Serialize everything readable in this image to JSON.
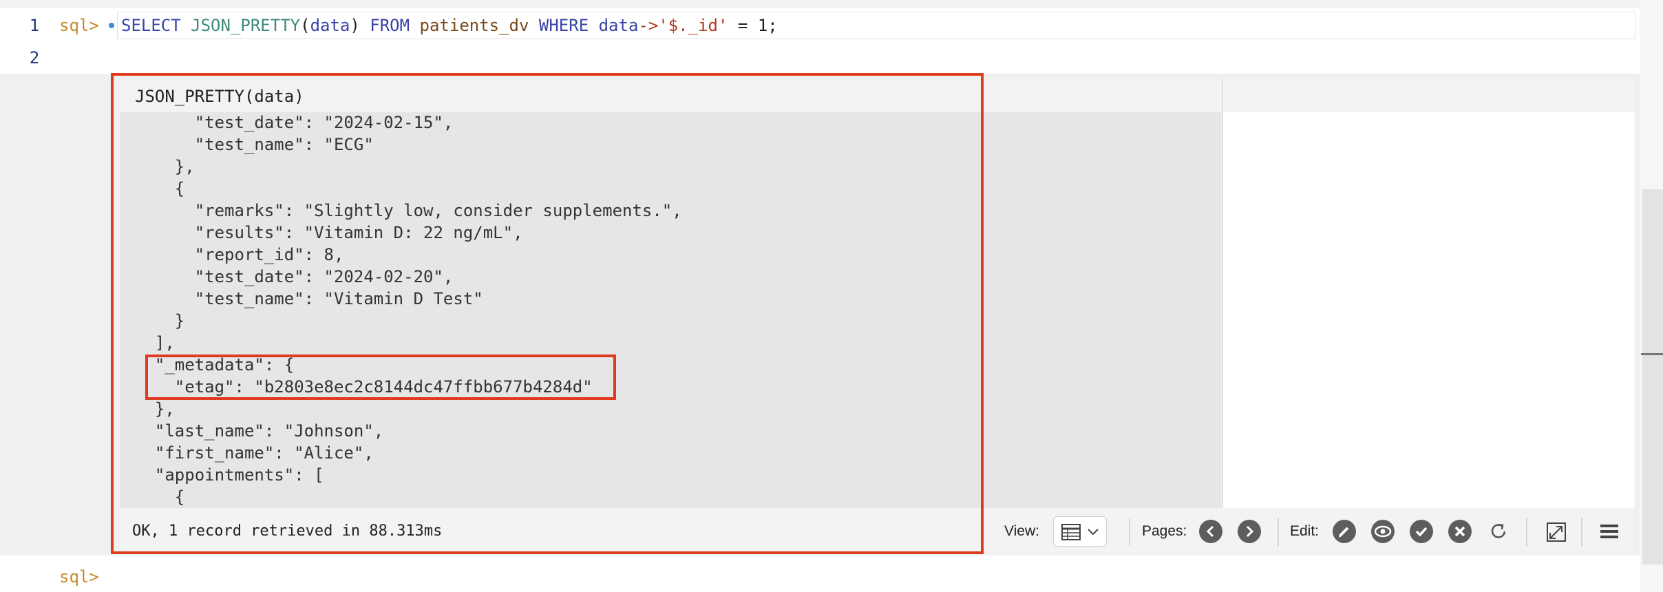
{
  "editor": {
    "line_numbers": [
      "1",
      "2"
    ],
    "prompt": "sql>",
    "query_tokens": [
      {
        "text": "SELECT ",
        "cls": "kw"
      },
      {
        "text": "JSON_PRETTY",
        "cls": "fn"
      },
      {
        "text": "(",
        "cls": "plain"
      },
      {
        "text": "data",
        "cls": "id"
      },
      {
        "text": ") ",
        "cls": "plain"
      },
      {
        "text": "FROM ",
        "cls": "kw"
      },
      {
        "text": "patients_dv ",
        "cls": "tbl"
      },
      {
        "text": "WHERE ",
        "cls": "kw"
      },
      {
        "text": "data",
        "cls": "id"
      },
      {
        "text": "->",
        "cls": "op"
      },
      {
        "text": "'$._id'",
        "cls": "str"
      },
      {
        "text": " = ",
        "cls": "plain"
      },
      {
        "text": "1",
        "cls": "plain"
      },
      {
        "text": ";",
        "cls": "plain"
      }
    ]
  },
  "result": {
    "column_header": "JSON_PRETTY(data)",
    "json_lines": [
      "      \"test_date\": \"2024-02-15\",",
      "      \"test_name\": \"ECG\"",
      "    },",
      "    {",
      "      \"remarks\": \"Slightly low, consider supplements.\",",
      "      \"results\": \"Vitamin D: 22 ng/mL\",",
      "      \"report_id\": 8,",
      "      \"test_date\": \"2024-02-20\",",
      "      \"test_name\": \"Vitamin D Test\"",
      "    }",
      "  ],",
      "  \"_metadata\": {",
      "    \"etag\": \"b2803e8ec2c8144dc47ffbb677b4284d\"",
      "  },",
      "  \"last_name\": \"Johnson\",",
      "  \"first_name\": \"Alice\",",
      "  \"appointments\": [",
      "    {"
    ],
    "status": "OK, 1 record retrieved in 88.313ms"
  },
  "toolbar": {
    "view_label": "View:",
    "pages_label": "Pages:",
    "edit_label": "Edit:",
    "icons": [
      "table-view-icon",
      "chevron-down-icon",
      "prev-page-icon",
      "next-page-icon",
      "edit-pencil-icon",
      "view-eye-icon",
      "confirm-check-icon",
      "discard-x-icon",
      "refresh-icon",
      "expand-icon",
      "menu-icon"
    ]
  },
  "bottom_prompt": "sql>"
}
